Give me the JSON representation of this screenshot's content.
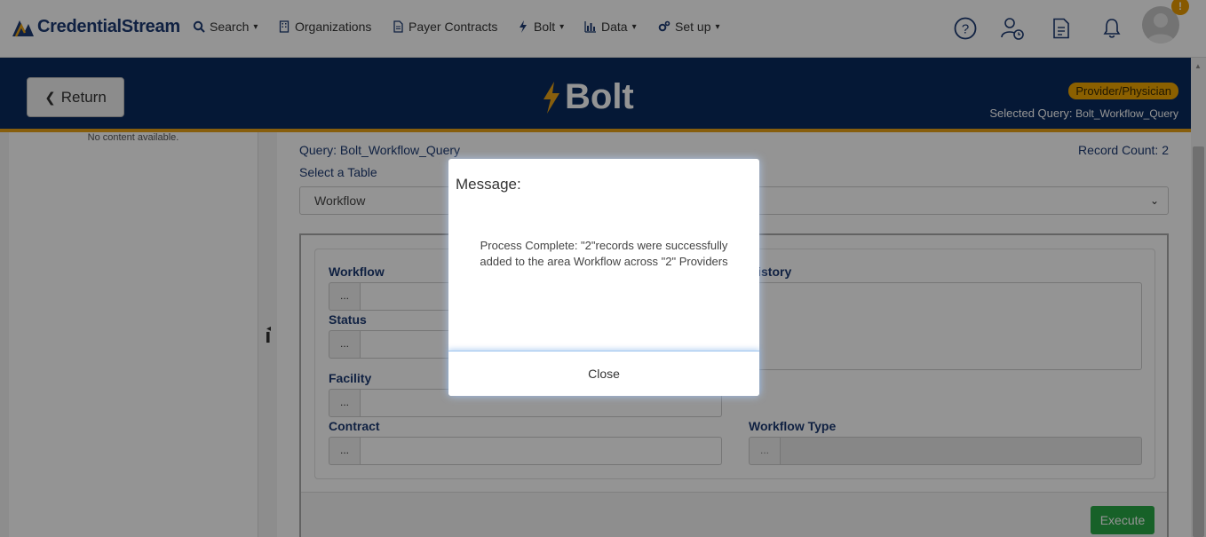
{
  "topnav": {
    "brand": "CredentialStream",
    "items": [
      {
        "label": "Search",
        "icon": "search-icon",
        "has_caret": true
      },
      {
        "label": "Organizations",
        "icon": "building-icon",
        "has_caret": false
      },
      {
        "label": "Payer Contracts",
        "icon": "document-icon",
        "has_caret": false
      },
      {
        "label": "Bolt",
        "icon": "bolt-icon",
        "has_caret": true
      },
      {
        "label": "Data",
        "icon": "bar-chart-icon",
        "has_caret": true
      },
      {
        "label": "Set up",
        "icon": "cogs-icon",
        "has_caret": true
      }
    ],
    "caret": "▾",
    "right_icons": [
      "help-icon",
      "user-clock-icon",
      "report-icon",
      "bell-icon"
    ],
    "avatar_badge": "!"
  },
  "banner": {
    "return_label": "Return",
    "app_name": "Bolt",
    "type_badge": "Provider/Physician",
    "selected_query_label": "Selected Query:",
    "selected_query_value": "Bolt_Workflow_Query"
  },
  "sidebar": {
    "empty_text": "No content available."
  },
  "main": {
    "query_title": "Query: Bolt_Workflow_Query",
    "record_count": "Record Count: 2",
    "select_label": "Select a Table",
    "selected_table": "Workflow",
    "fields": {
      "workflow": "Workflow",
      "status": "Status",
      "facility": "Facility",
      "contract": "Contract",
      "history": "History",
      "workflow_type": "Workflow Type",
      "dots": "..."
    },
    "execute_label": "Execute"
  },
  "modal": {
    "title": "Message:",
    "body": "Process Complete: \"2\"records were successfully added to the area Workflow across \"2\" Providers",
    "close_label": "Close"
  },
  "colors": {
    "brand_navy": "#0a2a5e",
    "accent_gold": "#e8a317",
    "execute_green": "#28a745",
    "label_blue": "#1c3a72"
  }
}
